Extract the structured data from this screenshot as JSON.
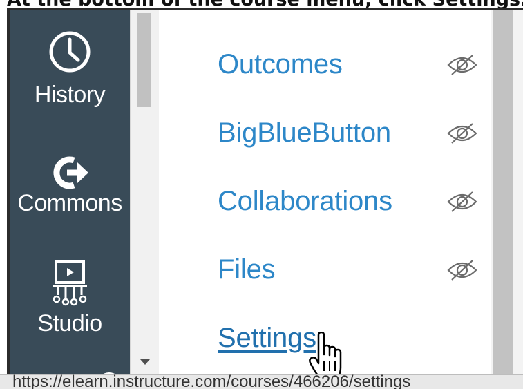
{
  "caption": {
    "text": "At the bottom of the course menu, click Settings."
  },
  "global_nav": {
    "items": [
      {
        "label": "History",
        "icon": "clock-icon"
      },
      {
        "label": "Commons",
        "icon": "commons-arrow-icon"
      },
      {
        "label": "Studio",
        "icon": "studio-icon"
      }
    ]
  },
  "course_menu": {
    "items": [
      {
        "label": "Outcomes",
        "hidden": true
      },
      {
        "label": "BigBlueButton",
        "hidden": true
      },
      {
        "label": "Collaborations",
        "hidden": true
      },
      {
        "label": "Files",
        "hidden": true
      },
      {
        "label": "Settings",
        "hidden": false,
        "active": true
      }
    ],
    "hidden_icon": "eye-slash-icon"
  },
  "status_bar": {
    "url": "https://elearn.instructure.com/courses/466206/settings"
  },
  "colors": {
    "nav_bg": "#394b58",
    "link": "#2d87c8",
    "nav_text": "#ffffff"
  }
}
